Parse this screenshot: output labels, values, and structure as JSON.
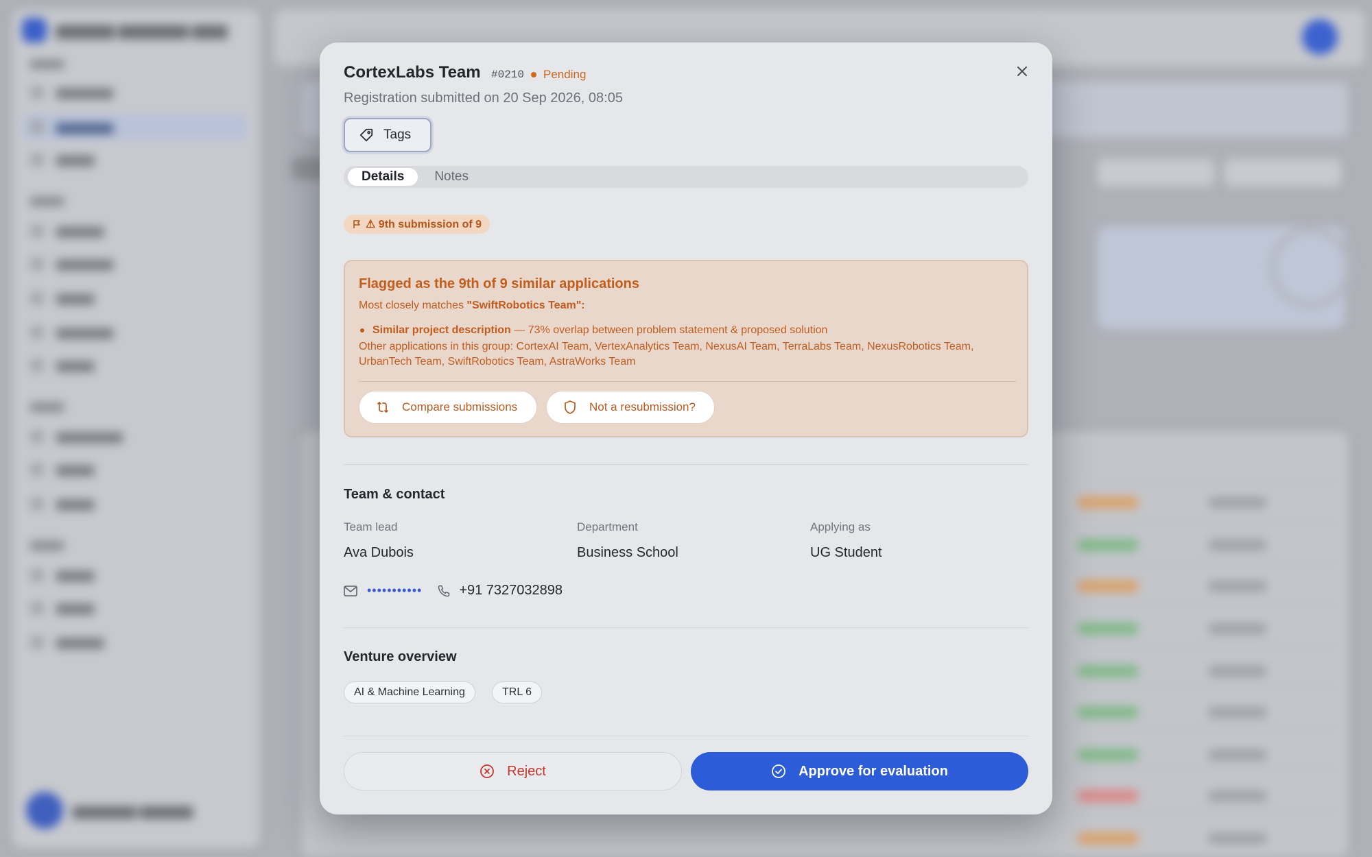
{
  "modal": {
    "title": "CortexLabs Team",
    "id": "#0210",
    "status": "Pending",
    "status_color": "#d06a1c",
    "subtitle": "Registration submitted on 20 Sep 2026, 08:05",
    "close_icon": "close-icon",
    "tags_label": "Tags",
    "tabs": [
      {
        "label": "Details",
        "active": true
      },
      {
        "label": "Notes",
        "active": false
      }
    ]
  },
  "flag": {
    "badge_label": "⚠ 9th submission of 9",
    "title": "Flagged as the 9th of 9 similar applications",
    "match_prefix": "Most closely matches ",
    "match_name": "\"SwiftRobotics Team\":",
    "bullet_bold": "Similar project description",
    "bullet_rest": " — 73% overlap between problem statement & proposed solution",
    "others": "Other applications in this group: CortexAI Team, VertexAnalytics Team, NexusAI Team, TerraLabs Team, NexusRobotics Team, UrbanTech Team, SwiftRobotics Team, AstraWorks Team",
    "compare_label": "Compare submissions",
    "not_resub_label": "Not a resubmission?",
    "accent_color": "#c25e1d"
  },
  "team": {
    "heading": "Team & contact",
    "fields": [
      {
        "label": "Team lead",
        "value": "Ava Dubois"
      },
      {
        "label": "Department",
        "value": "Business School"
      },
      {
        "label": "Applying as",
        "value": "UG Student"
      }
    ],
    "email_masked": "•••••••••••",
    "phone": "+91 7327032898"
  },
  "venture": {
    "heading": "Venture overview",
    "chips": [
      "AI & Machine Learning",
      "TRL 6"
    ]
  },
  "actions": {
    "reject_label": "Reject",
    "approve_label": "Approve for evaluation",
    "approve_color": "#2c5cd8",
    "reject_color": "#c4362d"
  }
}
